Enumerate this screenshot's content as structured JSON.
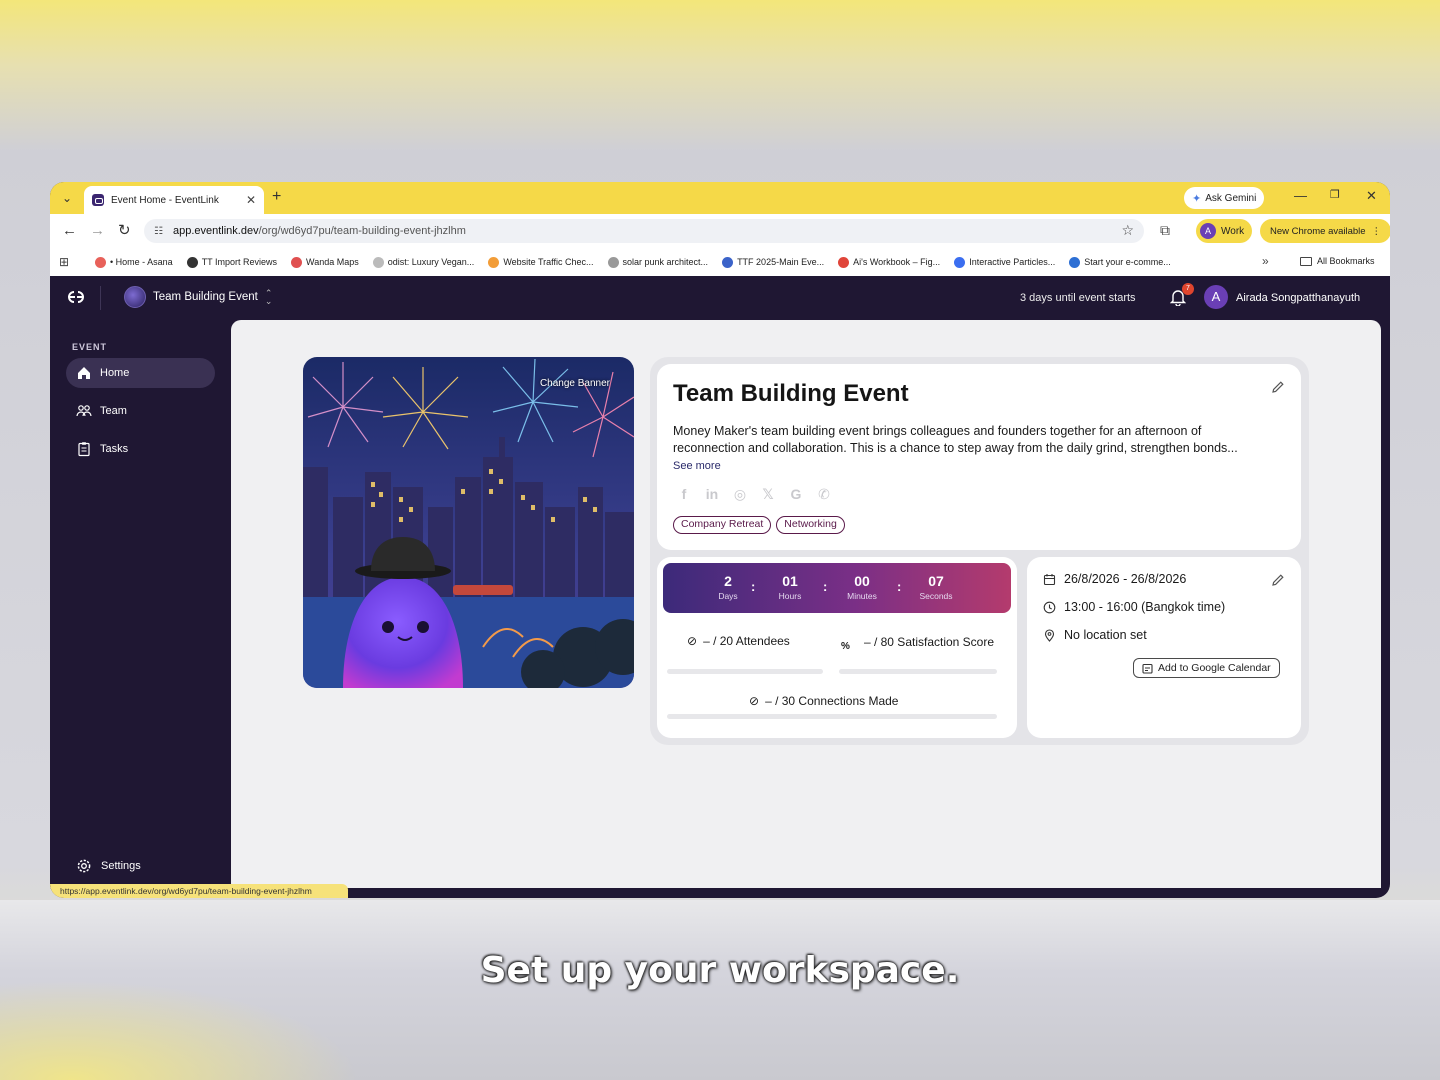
{
  "browser": {
    "tab_title": "Event Home - EventLink",
    "ask_gemini": "Ask Gemini",
    "url_host": "app.eventlink.dev",
    "url_path": "/org/wd6yd7pu/team-building-event-jhzlhm",
    "profile_label": "Work",
    "profile_initial": "A",
    "update_label": "New Chrome available",
    "bookmarks": [
      {
        "label": "• Home - Asana",
        "color": "#e8615a"
      },
      {
        "label": "TT Import Reviews",
        "color": "#333333"
      },
      {
        "label": "Wanda Maps",
        "color": "#e05050"
      },
      {
        "label": "odist: Luxury Vegan...",
        "color": "#bbbbbb"
      },
      {
        "label": "Website Traffic Chec...",
        "color": "#f29d38"
      },
      {
        "label": "solar punk architect...",
        "color": "#999999"
      },
      {
        "label": "TTF 2025-Main Eve...",
        "color": "#3b63c9"
      },
      {
        "label": "Ai's Workbook – Fig...",
        "color": "#e0453a"
      },
      {
        "label": "Interactive Particles...",
        "color": "#3b6ef0"
      },
      {
        "label": "Start your e-comme...",
        "color": "#2d6fd4"
      }
    ],
    "all_bookmarks": "All Bookmarks",
    "status_url": "https://app.eventlink.dev/org/wd6yd7pu/team-building-event-jhzlhm"
  },
  "app": {
    "event_name": "Team Building Event",
    "countdown_text": "3 days until event starts",
    "notification_count": "7",
    "user_initial": "A",
    "user_name": "Airada Songpatthanayuth"
  },
  "sidebar": {
    "section_label": "EVENT",
    "items": [
      {
        "label": "Home",
        "icon": "home-icon"
      },
      {
        "label": "Team",
        "icon": "team-icon"
      },
      {
        "label": "Tasks",
        "icon": "clipboard-icon"
      }
    ],
    "settings_label": "Settings"
  },
  "banner": {
    "change_label": "Change Banner"
  },
  "event": {
    "title": "Team Building Event",
    "description": "Money Maker's team building event brings colleagues and founders together for an afternoon of reconnection and collaboration. This is a chance to step away from the daily grind, strengthen bonds...",
    "see_more": "See more",
    "socials": [
      "facebook-icon",
      "linkedin-icon",
      "instagram-icon",
      "x-icon",
      "google-icon",
      "whatsapp-icon"
    ],
    "tags": [
      "Company Retreat",
      "Networking"
    ]
  },
  "countdown": {
    "units": [
      {
        "value": "2",
        "label": "Days"
      },
      {
        "value": "01",
        "label": "Hours"
      },
      {
        "value": "00",
        "label": "Minutes"
      },
      {
        "value": "07",
        "label": "Seconds"
      }
    ],
    "separator": ":"
  },
  "stats": {
    "attendees": "– / 20 Attendees",
    "satisfaction_symbol": "%",
    "satisfaction": "– / 80 Satisfaction Score",
    "connections": "– / 30 Connections Made"
  },
  "schedule": {
    "date": "26/8/2026 - 26/8/2026",
    "time": "13:00 - 16:00 (Bangkok time)",
    "location": "No location set",
    "gcal_label": "Add to Google Calendar"
  },
  "caption": "Set up your workspace."
}
